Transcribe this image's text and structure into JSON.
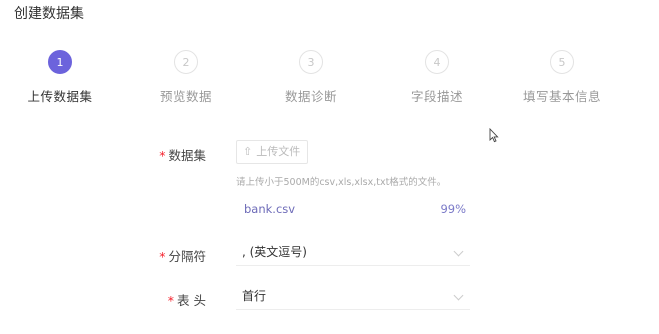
{
  "page": {
    "title": "创建数据集"
  },
  "steps": [
    {
      "num": "1",
      "label": "上传数据集",
      "active": true
    },
    {
      "num": "2",
      "label": "预览数据",
      "active": false
    },
    {
      "num": "3",
      "label": "数据诊断",
      "active": false
    },
    {
      "num": "4",
      "label": "字段描述",
      "active": false
    },
    {
      "num": "5",
      "label": "填写基本信息",
      "active": false
    }
  ],
  "form": {
    "dataset": {
      "required_mark": "*",
      "label": "数据集",
      "upload_label": "上传文件",
      "hint": "请上传小于500M的csv,xls,xlsx,txt格式的文件。",
      "file": {
        "name": "bank.csv",
        "progress": "99%"
      }
    },
    "delimiter": {
      "required_mark": "*",
      "label": "分隔符",
      "value": ", (英文逗号)"
    },
    "header": {
      "required_mark": "*",
      "label": "表 头",
      "value": "首行"
    }
  },
  "colors": {
    "accent": "#6c63dc",
    "required": "#f5222d",
    "file_link": "#6d6bb8"
  }
}
